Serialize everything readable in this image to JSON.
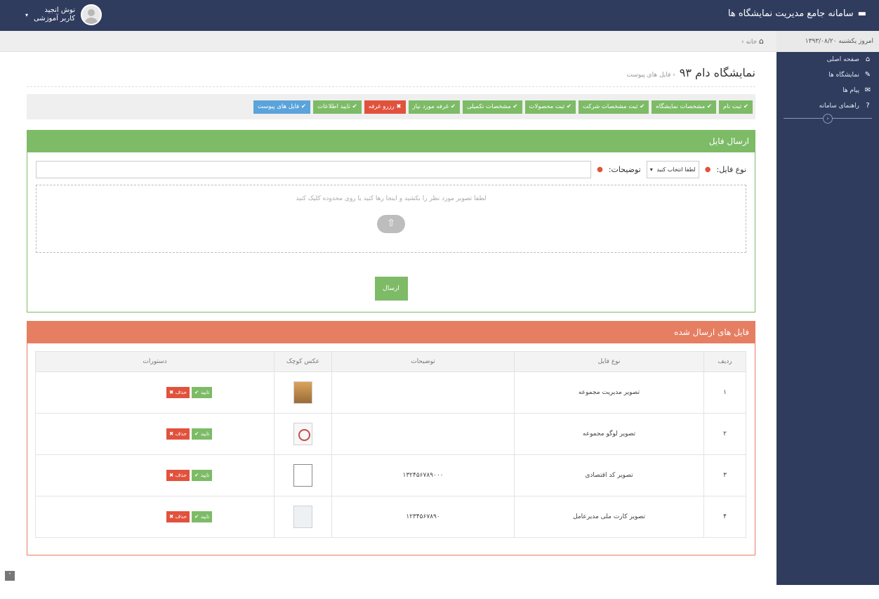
{
  "header": {
    "app_title": "سامانه جامع مدیریت نمایشگاه ها",
    "user_name": "نوش انجید",
    "user_role": "کاربر آموزشی",
    "user_caret": "▾",
    "brand_icon": "▬"
  },
  "sidebar": {
    "date": "امروز یکشنبه ۱۳۹۳/۰۸/۲۰",
    "items": [
      {
        "icon": "home-icon",
        "glyph": "⌂",
        "label": "صفحه اصلی"
      },
      {
        "icon": "edit-icon",
        "glyph": "✎",
        "label": "نمایشگاه ها"
      },
      {
        "icon": "mail-icon",
        "glyph": "✉",
        "label": "پیام ها"
      },
      {
        "icon": "help-icon",
        "glyph": "?",
        "label": "راهنمای سامانه"
      }
    ],
    "collapse_icon": "‹"
  },
  "breadcrumb": {
    "home_icon": "⌂",
    "label": "خانه",
    "separator": "›"
  },
  "page": {
    "title": "نمایشگاه دام ۹۳",
    "subtitle": "› فایل های پیوست"
  },
  "steps": [
    {
      "label": "✔ ثبت نام",
      "status": "done"
    },
    {
      "label": "✔ مشخصات نمایشگاه",
      "status": "done"
    },
    {
      "label": "✔ ثبت مشخصات شرکت",
      "status": "done"
    },
    {
      "label": "✔ ثبت محصولات",
      "status": "done"
    },
    {
      "label": "✔ مشخصات تکمیلی",
      "status": "done"
    },
    {
      "label": "✔ غرفه مورد نیاز",
      "status": "done"
    },
    {
      "label": "✖ رزرو غرفه",
      "status": "error"
    },
    {
      "label": "✔ تایید اطلاعات",
      "status": "done"
    },
    {
      "label": "✔ فایل های پیوست",
      "status": "active"
    }
  ],
  "upload": {
    "header": "ارسال فایل",
    "file_type_label": "نوع فایل:",
    "file_type_value": "لطفا انتخاب کنید",
    "desc_label": "توضیحات:",
    "dropzone_text": "لطفا تصویر مورد نظر را بکشید و اینجا رها کنید یا روی محدوده کلیک کنید",
    "cloud_icon": "upload-cloud-icon",
    "send_label": "ارسال"
  },
  "sent_files": {
    "header": "فایل های ارسال شده",
    "columns": [
      "ردیف",
      "نوع فایل",
      "توضیحات",
      "عکس کوچک",
      "دستورات"
    ],
    "rows": [
      {
        "index": "۱",
        "type": "تصویر مدیریت مجموعه",
        "desc": "",
        "confirm": "✔ تایید",
        "delete": "✖ حذف"
      },
      {
        "index": "۲",
        "type": "تصویر لوگو مجموعه",
        "desc": "",
        "confirm": "✔ تایید",
        "delete": "✖ حذف"
      },
      {
        "index": "۳",
        "type": "تصویر کد اقتصادی",
        "desc": "۱۳۲۴۵۶۷۸۹۰۰۰",
        "confirm": "✔ تایید",
        "delete": "✖ حذف"
      },
      {
        "index": "۴",
        "type": "تصویر کارت ملی مدیرعامل",
        "desc": "۱۲۳۴۵۶۷۸۹۰",
        "confirm": "✔ تایید",
        "delete": "✖ حذف"
      }
    ]
  },
  "colors": {
    "topbar": "#2f3c5e",
    "green": "#7dbb67",
    "red": "#e1523d",
    "blue": "#5aa3db",
    "orange_header": "#e67e62"
  }
}
